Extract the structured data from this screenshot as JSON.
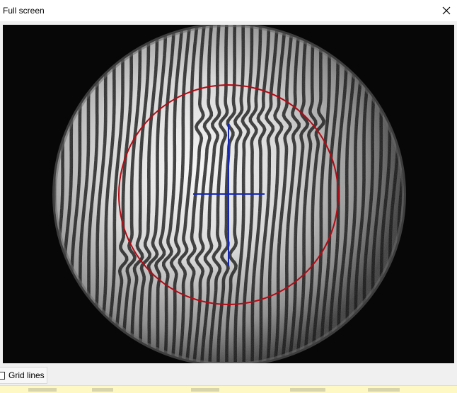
{
  "window": {
    "title": "Full screen",
    "close_icon": "close-icon"
  },
  "viewer": {
    "overlay_circle_color": "#b40a14",
    "crosshair_color": "#1428b8",
    "crosshair_icon": "crosshair-icon"
  },
  "footer": {
    "grid_lines_label": "Grid lines",
    "grid_lines_checked": false
  }
}
